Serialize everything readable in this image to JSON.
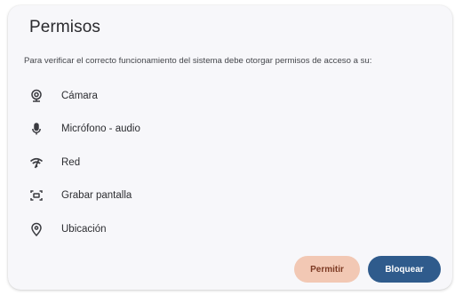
{
  "dialog": {
    "title": "Permisos",
    "description": "Para verificar el correcto funcionamiento del sistema debe otorgar permisos de acceso a su:",
    "permissions": [
      {
        "icon": "webcam-icon",
        "label": "Cámara"
      },
      {
        "icon": "microphone-icon",
        "label": "Micrófono - audio"
      },
      {
        "icon": "wifi-icon",
        "label": "Red"
      },
      {
        "icon": "screen-record-icon",
        "label": "Grabar pantalla"
      },
      {
        "icon": "location-icon",
        "label": "Ubicación"
      }
    ],
    "buttons": {
      "permit_label": "Permitir",
      "block_label": "Bloquear"
    },
    "colors": {
      "permit_bg": "#f2c8b4",
      "permit_text": "#7d3a23",
      "block_bg": "#2f5b8c",
      "block_text": "#ffffff"
    }
  }
}
